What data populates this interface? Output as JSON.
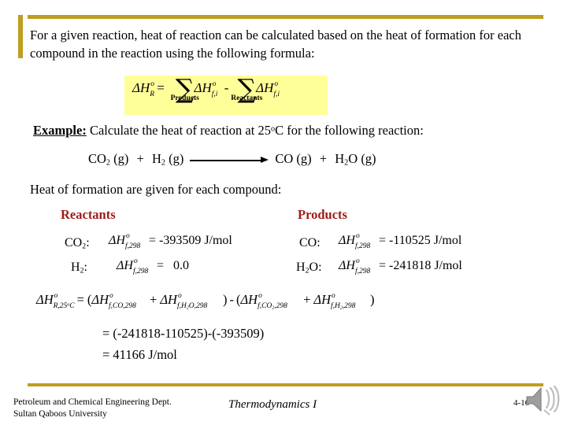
{
  "slide": {
    "intro_text": "For a given reaction, heat of reaction can be calculated based on the heat of formation for each compound in the reaction using the following formula:",
    "accent_color": "#bf9d1f",
    "highlight_color": "#ffff99",
    "header_color": "#9e1b1b"
  },
  "formula": {
    "lhs_delta": "Δ",
    "lhs_H": "H",
    "lhs_sup": "o",
    "lhs_sub": "R",
    "equals": "=",
    "sigma": "∑",
    "sigma_products_label": "Products",
    "sigma_reactants_label": "Reactants",
    "term_delta": "Δ",
    "term_H": "H",
    "term_sup": "o",
    "term_sub": "f,i",
    "minus": "-"
  },
  "example": {
    "label": "Example:",
    "text": "Calculate the heat of reaction at 25",
    "temp_sup": "o",
    "text_tail": "C for the following reaction:"
  },
  "reaction": {
    "reactant_1": "CO",
    "reactant_1_sub": "2",
    "reactant_1_state": "(g)",
    "plus": "+",
    "reactant_2": "H",
    "reactant_2_sub": "2",
    "reactant_2_state": "(g)",
    "arrow": "arrow-right",
    "product_1": "CO",
    "product_1_state": "(g)",
    "product_2": "H",
    "product_2_sub": "2",
    "product_2_tail": "O",
    "product_2_state": "(g)"
  },
  "table": {
    "caption": "Heat of formation are given for each compound:",
    "reactants_header": "Reactants",
    "products_header": "Products",
    "reactants": [
      {
        "species": "CO",
        "species_sub": "2",
        "colon": ":",
        "symbol_delta": "Δ",
        "symbol_H": "H",
        "symbol_sup": "o",
        "symbol_sub": "f,298",
        "equals": "=",
        "value": "-393509",
        "units": "J/mol"
      },
      {
        "species": "H",
        "species_sub": "2",
        "colon": ":",
        "symbol_delta": "Δ",
        "symbol_H": "H",
        "symbol_sup": "o",
        "symbol_sub": "f,298",
        "equals": "=",
        "value": "0.0",
        "units": ""
      }
    ],
    "products": [
      {
        "species": "CO",
        "species_sub": "",
        "colon": ":",
        "symbol_delta": "Δ",
        "symbol_H": "H",
        "symbol_sup": "o",
        "symbol_sub": "f,298",
        "equals": "=",
        "value": "-110525",
        "units": "J/mol"
      },
      {
        "species": "H",
        "species_sub": "2",
        "species_tail": "O",
        "colon": ":",
        "symbol_delta": "Δ",
        "symbol_H": "H",
        "symbol_sup": "o",
        "symbol_sub": "f,298",
        "equals": "=",
        "value": "-241818",
        "units": "J/mol"
      }
    ]
  },
  "derivation": {
    "lhs_delta": "Δ",
    "lhs_H": "H",
    "lhs_sup": "o",
    "lhs_sub": "R,25",
    "lhs_sub_deg": "o",
    "lhs_sub_c": "C",
    "equals": "=",
    "open_paren": "(",
    "t1_delta": "Δ",
    "t1_H": "H",
    "t1_sup": "o",
    "t1_sub": "f,CO,298",
    "plus": "+",
    "t2_delta": "Δ",
    "t2_H": "H",
    "t2_sup": "o",
    "t2_sub_a": "f,H",
    "t2_sub_num": "2",
    "t2_sub_b": "O,298",
    "close_paren": ")",
    "minus": "-",
    "t3_delta": "Δ",
    "t3_H": "H",
    "t3_sup": "o",
    "t3_sub_a": "f,CO",
    "t3_sub_num": "2",
    "t3_sub_b": ",298",
    "t4_delta": "Δ",
    "t4_H": "H",
    "t4_sup": "o",
    "t4_sub_a": "f,H",
    "t4_sub_num": "2",
    "t4_sub_b": ",298"
  },
  "results": {
    "line_1": "= (-241818-110525)-(-393509)",
    "line_2": "= 41166  J/mol"
  },
  "footer": {
    "dept_line_1": "Petroleum and Chemical Engineering Dept.",
    "dept_line_2": "Sultan Qaboos University",
    "course": "Thermodynamics I",
    "slide_number": "4-16",
    "speaker_icon": "speaker-sound-icon"
  }
}
